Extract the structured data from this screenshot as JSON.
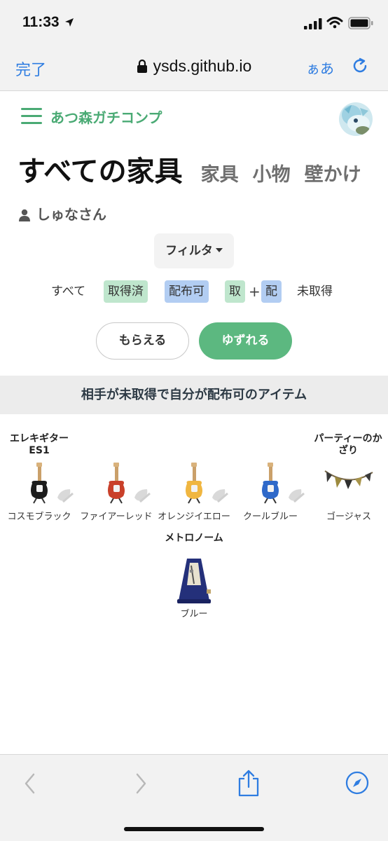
{
  "status_bar": {
    "time": "11:33"
  },
  "browser": {
    "done_label": "完了",
    "url": "ysds.github.io",
    "text_size_label": "ぁあ"
  },
  "app": {
    "brand": "あつ森ガチコンプ",
    "tabs": [
      {
        "label": "すべての家具",
        "active": true
      },
      {
        "label": "家具"
      },
      {
        "label": "小物"
      },
      {
        "label": "壁かけ"
      }
    ],
    "user_name": "しゅなさん",
    "filter_label": "フィルタ",
    "status_filters": [
      {
        "label": "すべて",
        "style": "plain"
      },
      {
        "label": "取得済",
        "style": "green"
      },
      {
        "label": "配布可",
        "style": "blue"
      },
      {
        "label": "取",
        "style": "green"
      },
      {
        "label": "+",
        "style": "plus"
      },
      {
        "label": "配",
        "style": "blue"
      },
      {
        "label": "未取得",
        "style": "plain"
      }
    ],
    "actions": {
      "receive": "もらえる",
      "give": "ゆずれる"
    },
    "section_banner": "相手が未取得で自分が配布可のアイテム",
    "groups": [
      {
        "title": "エレキギターES1",
        "title_lines": [
          "エレキギター",
          "ES1"
        ],
        "variants": [
          {
            "label": "コスモブラック",
            "color": "#1c1c1c"
          },
          {
            "label": "ファイアーレッド",
            "color": "#c9402a"
          },
          {
            "label": "オレンジイエロー",
            "color": "#f0b640"
          },
          {
            "label": "クールブルー",
            "color": "#2f69c9"
          }
        ]
      },
      {
        "title": "パーティーのかざり",
        "title_lines": [
          "パーティーのか",
          "ざり"
        ],
        "variants": [
          {
            "label": "ゴージャス"
          }
        ]
      },
      {
        "title": "メトロノーム",
        "title_lines": [
          "メトロノーム"
        ],
        "variants": [
          {
            "label": "ブルー",
            "color": "#24307a"
          }
        ]
      }
    ]
  },
  "colors": {
    "accent_green": "#4aaa74",
    "button_green": "#5cb880",
    "chip_green": "#bfe6cd",
    "chip_blue": "#b2cdf2",
    "ios_blue": "#2f7de1"
  },
  "icons": {
    "status": [
      "location-arrow-icon",
      "signal-icon",
      "wifi-icon",
      "battery-icon"
    ],
    "browser": [
      "lock-icon",
      "reload-icon"
    ],
    "toolbar": [
      "back-icon",
      "forward-icon",
      "share-icon",
      "compass-icon"
    ]
  }
}
